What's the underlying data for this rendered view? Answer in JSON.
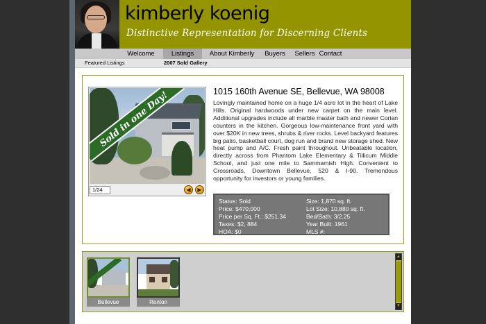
{
  "header": {
    "brand_name": "kimberly koenig",
    "tagline": "Distinctive Representation for Discerning Clients"
  },
  "nav": {
    "items": [
      {
        "label": "Welcome",
        "active": false
      },
      {
        "label": "Listings",
        "active": true
      },
      {
        "label": "About Kimberly",
        "active": false
      },
      {
        "label": "Buyers",
        "active": false
      },
      {
        "label": "Sellers",
        "active": false
      },
      {
        "label": "Contact",
        "active": false
      }
    ]
  },
  "subnav": {
    "items": [
      {
        "label": "Featured Listings",
        "active": false
      },
      {
        "label": "2007 Sold Gallery",
        "active": true
      }
    ]
  },
  "listing": {
    "banner": "Sold in one Day!",
    "photo_counter": "1/24",
    "title": "1015 160th Avenue SE, Bellevue, WA 98008",
    "description": "Lovingly maintained home on a huge 1/4 acre lot in the heart of Lake Hills. Original hardwoods under new carpet on the main level. Additional upgrades include all marble master bath and newer Corian counters in the kitchen. Gorgeous low-maintenance front yard with over $20K in new trees, shrubs & river rocks. Level backyard features big patio, basketball court, dog run and brand new storage shed. New heat pump and A/C. Fresh paint throughout. Unbeatable location, directly across from Phantom Lake Elementary & Tillicum Middle School, and just one mile to Sammamish High. Convenient to Crossroads, Downtown Bellevue, 520 & I-90. Tremendous opportunity for investors or young families.",
    "facts_left": [
      "Status: Sold",
      "Price: $470,000",
      "Price per Sq. Ft.: $251.34",
      "Taxes: $2, 884",
      "HOA: $0"
    ],
    "facts_right": [
      "Size: 1,870 sq. ft.",
      "Lot Size: 10,880 sq. ft.",
      "Bed/Bath: 3/2.25",
      "Year Built: 1961",
      "MLS #:"
    ]
  },
  "thumbnails": [
    {
      "label": "Bellevue",
      "selected": true
    },
    {
      "label": "Renton",
      "selected": false
    }
  ],
  "icons": {
    "prev": "arrow-left-icon",
    "next": "arrow-right-icon",
    "scroll_up": "scroll-up-icon",
    "scroll_down": "scroll-down-icon"
  },
  "colors": {
    "header_bg": "#949400",
    "accent_border": "#9a9a26",
    "facts_bg": "#777777"
  }
}
